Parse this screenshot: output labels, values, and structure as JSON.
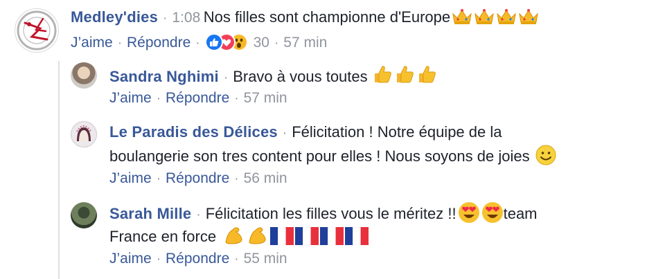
{
  "thread": {
    "main_comment": {
      "author": "Medley'dies",
      "timecode": "1:08",
      "text": "Nos filles sont championne d'Europe",
      "emojis": [
        "crown",
        "crown",
        "crown",
        "crown"
      ],
      "actions": {
        "like": "J’aime",
        "reply": "Répondre"
      },
      "reactions": {
        "types": [
          "like",
          "love",
          "wow"
        ],
        "count": "30"
      },
      "time_ago": "57 min"
    },
    "replies": [
      {
        "author": "Sandra Nghimi",
        "text_line1": "Bravo à vous toutes",
        "emojis": [
          "thumbs-up",
          "thumbs-up",
          "thumbs-up"
        ],
        "actions": {
          "like": "J’aime",
          "reply": "Répondre"
        },
        "time_ago": "57 min"
      },
      {
        "author": "Le Paradis des Délices",
        "text_line1": "Félicitation ! Notre équipe de la",
        "text_line2": "boulangerie son tres content pour elles ! Nous soyons de joies",
        "emojis": [
          "smiley"
        ],
        "actions": {
          "like": "J’aime",
          "reply": "Répondre"
        },
        "time_ago": "56 min"
      },
      {
        "author": "Sarah Mille",
        "text_line1": "Félicitation les filles vous le méritez !!",
        "text_line1_after": "team",
        "text_line2": "France en force",
        "emojis": [
          "heart-eyes",
          "heart-eyes",
          "flexed-biceps",
          "flexed-biceps",
          "flag-france",
          "flag-france",
          "flag-france",
          "flag-france"
        ],
        "actions": {
          "like": "J’aime",
          "reply": "Répondre"
        },
        "time_ago": "55 min"
      }
    ]
  },
  "colors": {
    "link": "#385898",
    "muted": "#90949c",
    "text": "#1d2129",
    "like_blue": "#1877f2",
    "love_red": "#f33e58",
    "emoji_yellow": "#f7b928"
  }
}
